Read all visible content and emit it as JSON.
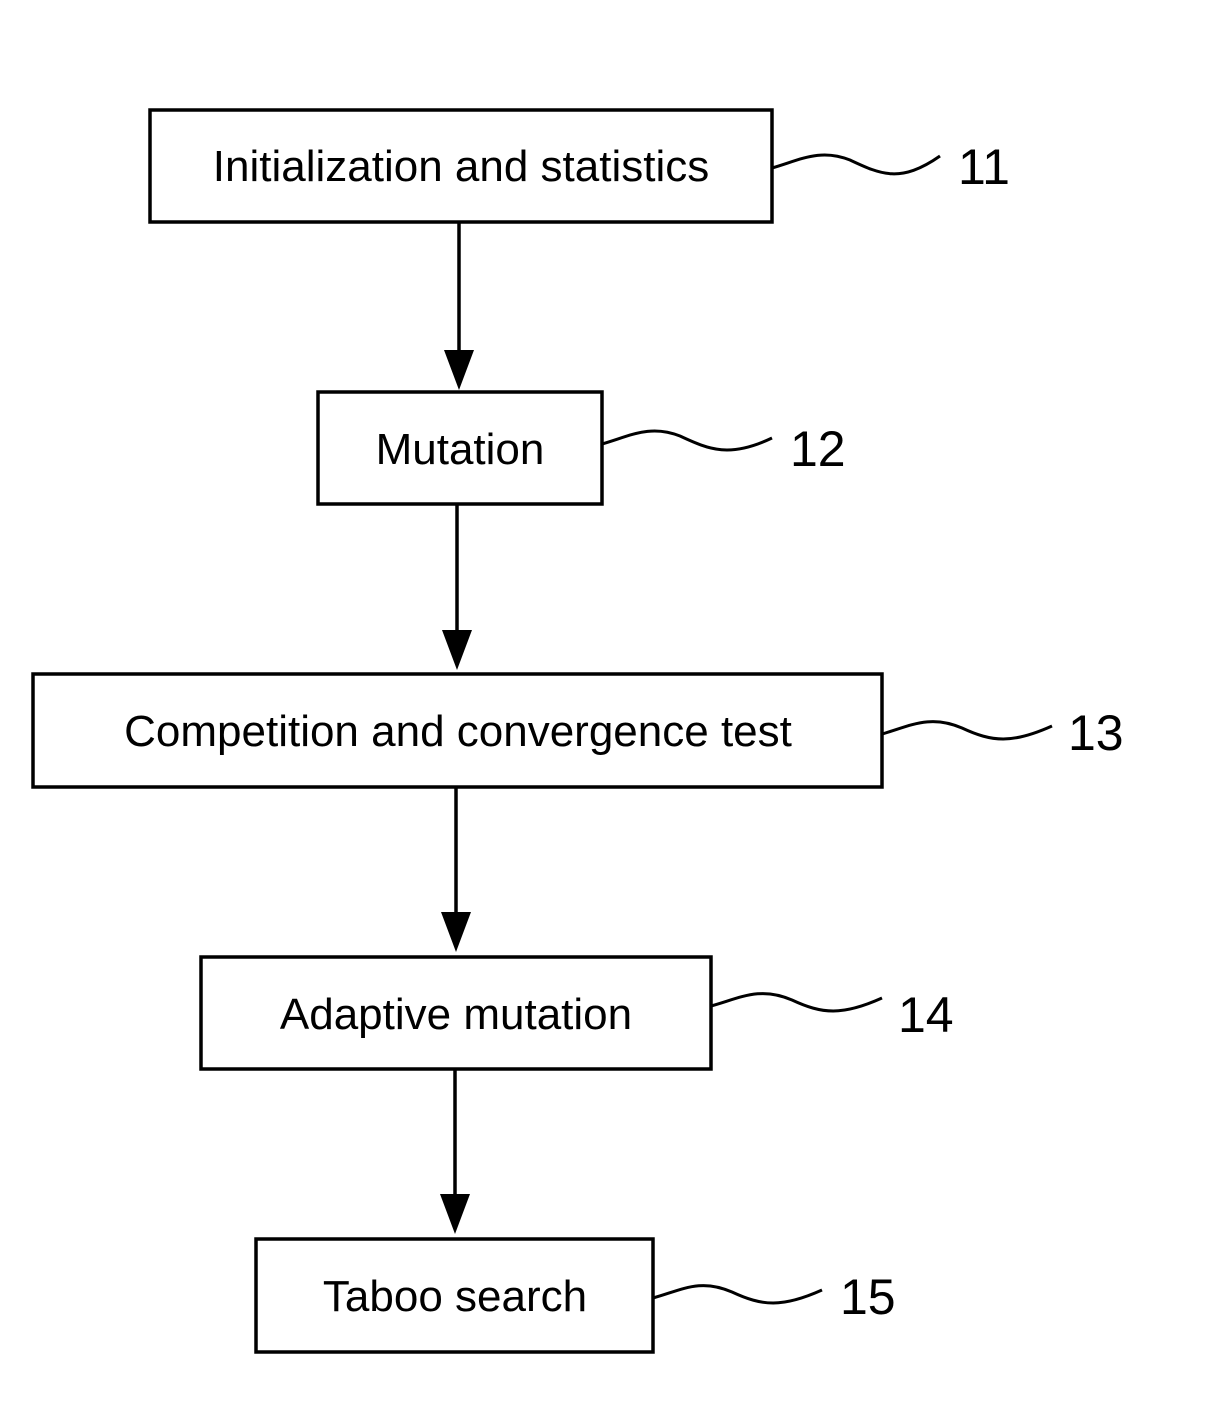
{
  "diagram": {
    "type": "flowchart",
    "steps": [
      {
        "label": "Initialization and statistics",
        "ref": "11"
      },
      {
        "label": "Mutation",
        "ref": "12"
      },
      {
        "label": "Competition and convergence test",
        "ref": "13"
      },
      {
        "label": "Adaptive mutation",
        "ref": "14"
      },
      {
        "label": "Taboo search",
        "ref": "15"
      }
    ],
    "edges": [
      {
        "from": "11",
        "to": "12"
      },
      {
        "from": "12",
        "to": "13"
      },
      {
        "from": "13",
        "to": "14"
      },
      {
        "from": "14",
        "to": "15"
      }
    ]
  }
}
